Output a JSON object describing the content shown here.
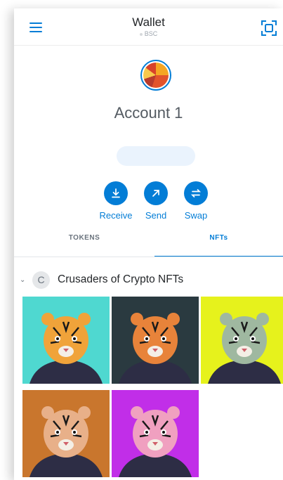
{
  "header": {
    "title": "Wallet",
    "network": "BSC"
  },
  "account": {
    "name": "Account 1",
    "address": ""
  },
  "actions": [
    {
      "label": "Receive",
      "icon": "download-icon"
    },
    {
      "label": "Send",
      "icon": "arrow-up-right-icon"
    },
    {
      "label": "Swap",
      "icon": "swap-icon"
    }
  ],
  "tabs": [
    {
      "label": "TOKENS",
      "active": false
    },
    {
      "label": "NFTs",
      "active": true
    }
  ],
  "collection": {
    "name": "Crusaders of Crypto NFTs",
    "initial": "C"
  },
  "nfts": [
    {
      "bg": "#4fd8d0",
      "fur": "#f0a33a"
    },
    {
      "bg": "#2a3a40",
      "fur": "#e8833a"
    },
    {
      "bg": "#e6f21c",
      "fur": "#9fb8a0"
    },
    {
      "bg": "#c9762d",
      "fur": "#e8b089"
    },
    {
      "bg": "#c12ee8",
      "fur": "#f0a0c0"
    }
  ],
  "colors": {
    "accent": "#037dd6"
  }
}
